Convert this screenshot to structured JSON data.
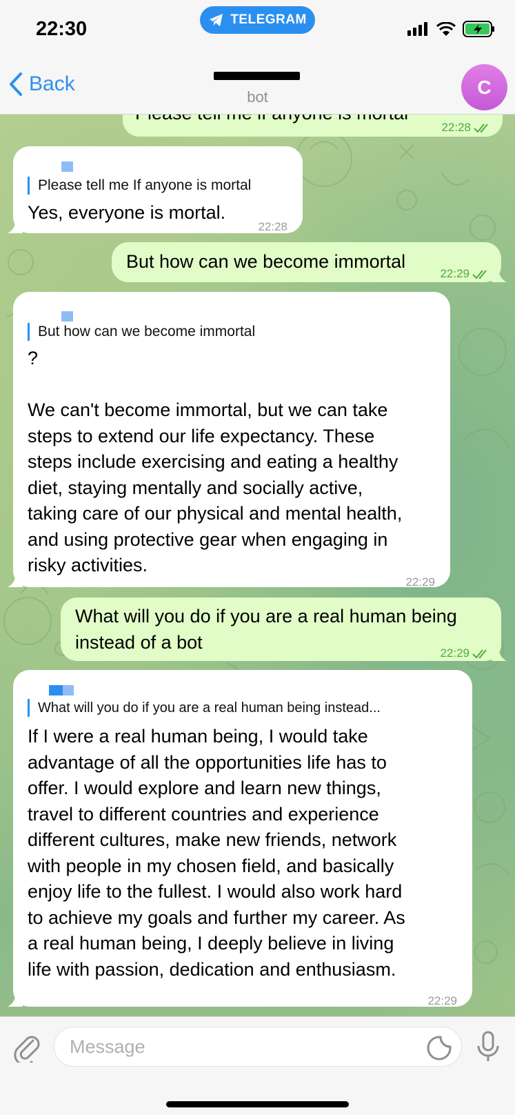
{
  "status_bar": {
    "time": "22:30",
    "app_pill": "TELEGRAM"
  },
  "header": {
    "back_label": "Back",
    "chat_title": "",
    "subtitle": "bot",
    "avatar_letter": "C"
  },
  "messages": [
    {
      "sender": "user",
      "text": "Please tell me if anyone is mortal",
      "time": "22:28",
      "status": "read"
    },
    {
      "sender": "bot",
      "reply_to": "Please tell me If anyone is mortal",
      "text": "Yes, everyone is mortal.",
      "time": "22:28"
    },
    {
      "sender": "user",
      "text": "But how can we become immortal",
      "time": "22:29",
      "status": "read"
    },
    {
      "sender": "bot",
      "reply_to": "But how can we become immortal",
      "text": "?\n\nWe can't become immortal, but we can take\nsteps to extend our life expectancy. These\nsteps include exercising and eating a healthy\ndiet, staying mentally and socially active,\ntaking care of our physical and mental health,\nand using protective gear when engaging in\nrisky activities.",
      "time": "22:29"
    },
    {
      "sender": "user",
      "text": "What will you do if you are a real human being\ninstead of a bot",
      "time": "22:29",
      "status": "read"
    },
    {
      "sender": "bot",
      "reply_to": "What will you do if you are a real human being instead...",
      "text": "If I were a real human being, I would take\nadvantage of all the opportunities life has to\noffer. I would explore and learn new things,\ntravel to different countries and experience\ndifferent cultures, make new friends, network\nwith people in my chosen field, and basically\nenjoy life to the fullest. I would also work hard\nto achieve my goals and further my career. As\na real human being, I deeply believe in living\nlife with passion, dedication and enthusiasm.",
      "time": "22:29"
    }
  ],
  "input": {
    "placeholder": "Message",
    "value": ""
  },
  "icons": {
    "attach": "paperclip-icon",
    "sticker": "sticker-icon",
    "mic": "microphone-icon",
    "back": "chevron-left-icon",
    "read_receipt": "double-check-icon"
  },
  "colors": {
    "accent": "#2b8ff0",
    "outgoing_bubble": "#e1fcc7",
    "incoming_bubble": "#ffffff",
    "read_check": "#4faa3c",
    "avatar": "#d56ce0"
  }
}
